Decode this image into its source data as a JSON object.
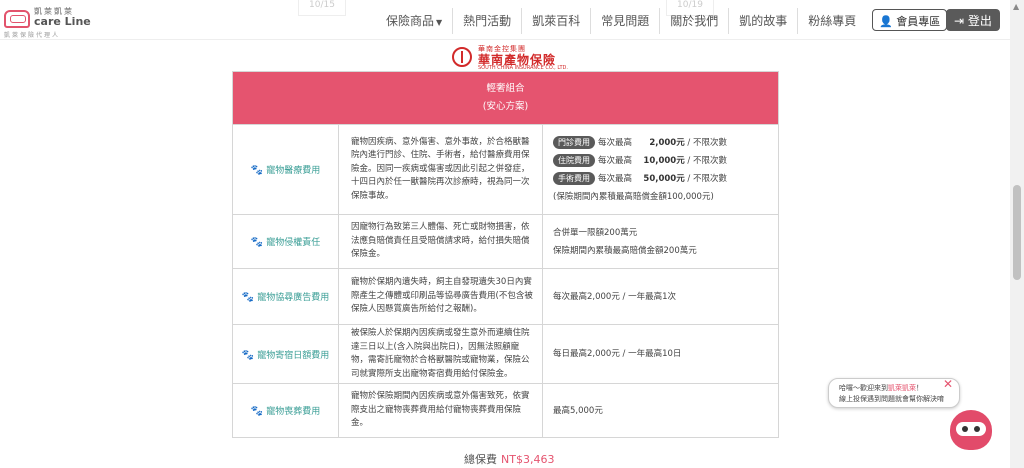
{
  "header": {
    "logo": {
      "brand_cn": "凱萊凱萊",
      "brand_en": "care Line",
      "brand_sub": "凱萊保險代理人"
    },
    "ghost_dates": [
      "10/15",
      "10/19"
    ],
    "nav": [
      {
        "label": "保險商品",
        "has_caret": true
      },
      {
        "label": "熱門活動"
      },
      {
        "label": "凱萊百科"
      },
      {
        "label": "常見問題"
      },
      {
        "label": "關於我們"
      },
      {
        "label": "凱的故事"
      },
      {
        "label": "粉絲專頁"
      }
    ],
    "member_button": "會員專區",
    "logout_button": "登出"
  },
  "insurer": {
    "group": "華南金控集團",
    "name": "華南產物保險",
    "en": "SOUTH CHINA INSURANCE CO., LTD."
  },
  "plan": {
    "title": "輕奢組合",
    "subtitle": "(安心方案)",
    "rows": [
      {
        "item": "寵物醫療費用",
        "desc": "寵物因疾病、意外傷害、意外事故，於合格獸醫院內進行門診、住院、手術者，給付醫療費用保險金。因同一疾病或傷害或因此引起之併發症，十四日內於任一獸醫院再次診療時，視為同一次保險事故。",
        "values": [
          {
            "tag": "門診費用",
            "prefix": "每次最高",
            "amount": "2,000元",
            "suffix": "/ 不限次數"
          },
          {
            "tag": "住院費用",
            "prefix": "每次最高",
            "amount": "10,000元",
            "suffix": "/ 不限次數"
          },
          {
            "tag": "手術費用",
            "prefix": "每次最高",
            "amount": "50,000元",
            "suffix": "/ 不限次數"
          }
        ],
        "note": "(保險期間內累積最高賠償金額100,000元)"
      },
      {
        "item": "寵物侵權責任",
        "desc": "因寵物行為致第三人體傷、死亡或財物損害，依法應負賠償責任且受賠償請求時，給付損失賠償保險金。",
        "lines": [
          "合併單一限額200萬元",
          "保險期間內累積最高賠償金額200萬元"
        ]
      },
      {
        "item": "寵物協尋廣告費用",
        "desc": "寵物於保期內遺失時，飼主自發現遺失30日內實際產生之傳體或印刷品等協尋廣告費用(不包含被保險人因懸賞廣告所給付之報酬)。",
        "lines": [
          "每次最高2,000元 / 一年最高1次"
        ]
      },
      {
        "item": "寵物寄宿日額費用",
        "desc": "被保險人於保期內因疾病或發生意外而連續住院達三日以上(含入院與出院日)，因無法照顧寵物，需寄託寵物於合格獸醫院或寵物業，保險公司就實際所支出寵物寄宿費用給付保險金。",
        "lines": [
          "每日最高2,000元 / 一年最高10日"
        ]
      },
      {
        "item": "寵物喪葬費用",
        "desc": "寵物於保險期間內因疾病或意外傷害致死，依實際支出之寵物喪葬費用給付寵物喪葬費用保險金。",
        "lines": [
          "最高5,000元"
        ]
      }
    ],
    "total_label": "總保費",
    "total_price": "NT$3,463"
  },
  "chat": {
    "line1_prefix": "哈囉～歡迎來到",
    "line1_highlight": "凱萊凱萊",
    "line1_suffix": "！",
    "line2": "線上投保遇到問題就會幫你解決唷",
    "close": "✕"
  },
  "colors": {
    "accent": "#e5546f",
    "teal": "#3a9e96",
    "dark": "#5a5a5a"
  }
}
